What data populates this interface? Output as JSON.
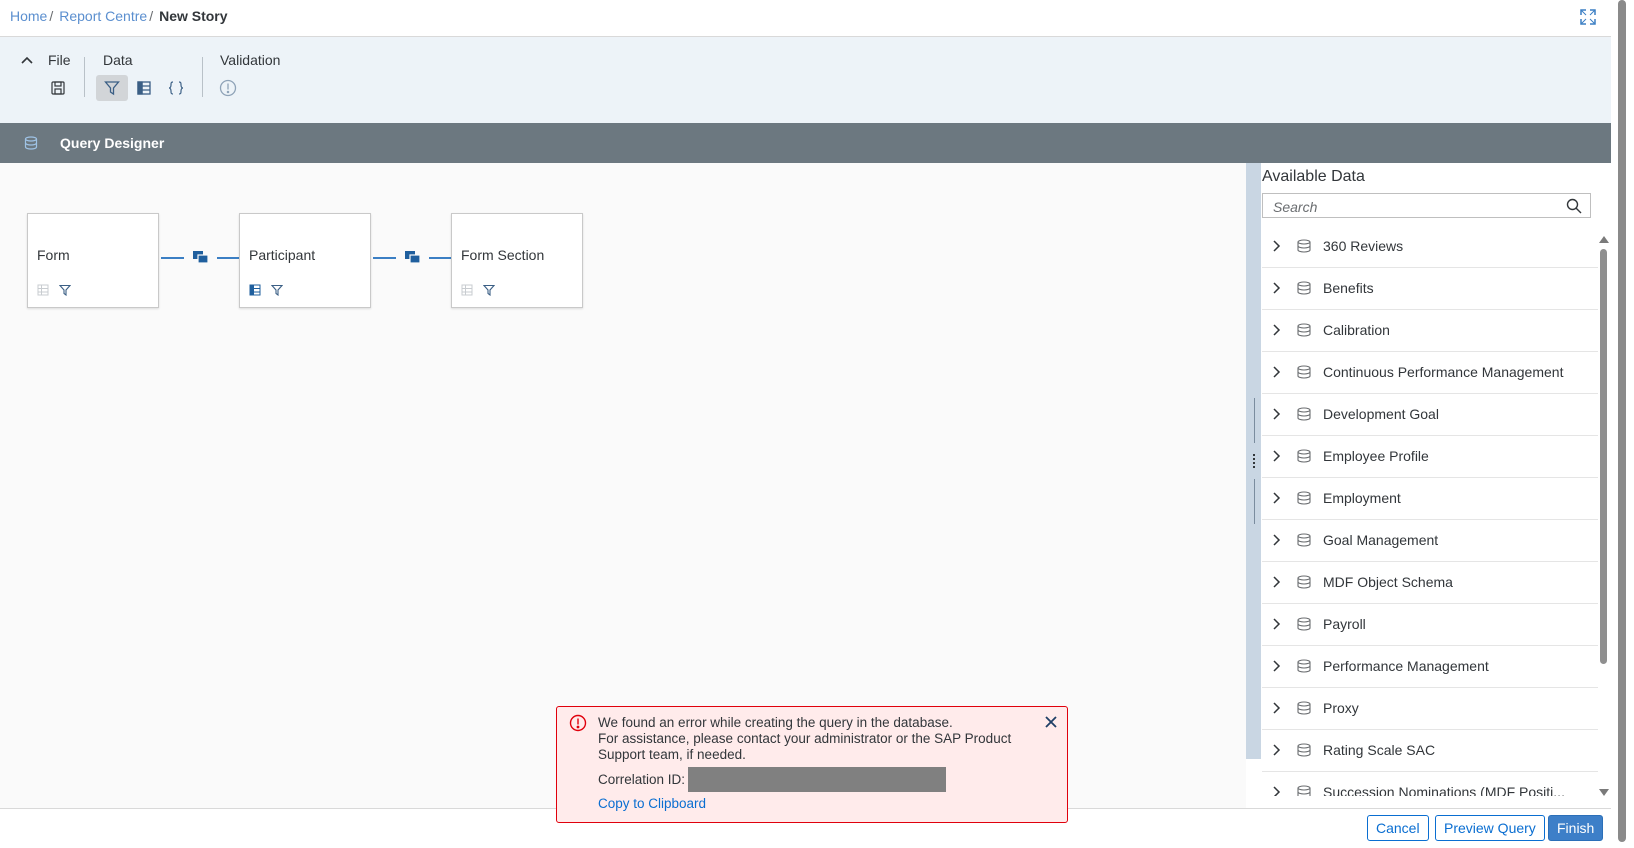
{
  "breadcrumb": {
    "items": [
      "Home",
      "Report Centre"
    ],
    "separator": "/",
    "current": "New Story"
  },
  "toolbar": {
    "groups": {
      "file": "File",
      "data": "Data",
      "validation": "Validation"
    },
    "icons": [
      "save-icon",
      "filter-icon",
      "table-icon",
      "formula-icon",
      "validation-warning-icon"
    ]
  },
  "query_designer": {
    "title": "Query Designer"
  },
  "nodes": [
    {
      "label": "Form"
    },
    {
      "label": "Participant"
    },
    {
      "label": "Form Section"
    }
  ],
  "available_data": {
    "title": "Available Data",
    "search_placeholder": "Search",
    "items": [
      "360 Reviews",
      "Benefits",
      "Calibration",
      "Continuous Performance Management",
      "Development Goal",
      "Employee Profile",
      "Employment",
      "Goal Management",
      "MDF Object Schema",
      "Payroll",
      "Performance Management",
      "Proxy",
      "Rating Scale SAC",
      "Succession Nominations (MDF Positi..."
    ]
  },
  "error": {
    "line1": "We found an error while creating the query in the database.",
    "line2": "For assistance, please contact your administrator or the SAP Product Support team, if needed.",
    "correlation_label": "Correlation ID:",
    "copy_label": "Copy to Clipboard"
  },
  "footer": {
    "cancel": "Cancel",
    "preview": "Preview Query",
    "finish": "Finish"
  },
  "colors": {
    "accent": "#0a6ed1",
    "header_bar": "#6c7880",
    "toolbar_bg": "#edf3f8",
    "error_bg": "#ffebeb",
    "error_border": "#e0000c",
    "connector": "#3b7fc4"
  }
}
